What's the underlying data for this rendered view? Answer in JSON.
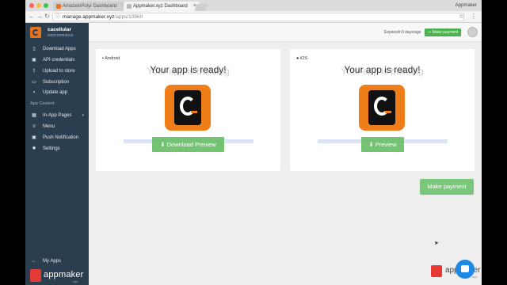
{
  "browser": {
    "tabs": [
      {
        "label": "AmazeinPolyr Dashboard",
        "active": false
      },
      {
        "label": "Appmaker.xyz Dashboard",
        "active": true
      }
    ],
    "profile_name": "Appmaker",
    "url_host": "manage.appmaker.xyz",
    "url_path": "/apps/10960"
  },
  "sidebar": {
    "app_name": "cacellular",
    "app_subtitle": "woocommerce",
    "items": [
      {
        "label": "Download Apps",
        "icon": "phone-icon"
      },
      {
        "label": "API credentials",
        "icon": "lock-icon"
      },
      {
        "label": "Upload to store",
        "icon": "upload-icon"
      },
      {
        "label": "Subscription",
        "icon": "card-icon"
      },
      {
        "label": "Update app",
        "icon": "update-icon"
      }
    ],
    "section_title": "App Content",
    "content_items": [
      {
        "label": "In-App Pages",
        "icon": "grid-icon"
      },
      {
        "label": "Menu",
        "icon": "list-icon"
      },
      {
        "label": "Push Notification",
        "icon": "bell-icon"
      },
      {
        "label": "Settings",
        "icon": "gear-icon"
      }
    ],
    "my_apps": "My Apps",
    "logo_text": "appmaker",
    "logo_sub": ".xyz"
  },
  "topbar": {
    "expires_text": "Expires/in3 days/age",
    "make_payment_small": "Make payment"
  },
  "cards": [
    {
      "platform": "Android",
      "heading": "Your app is ready!",
      "ghost_text": "Your app is building",
      "button": "Download Preview",
      "progress_fraction": 1.0
    },
    {
      "platform": "iOS",
      "heading": "Your app is ready!",
      "ghost_text": "Your app is building",
      "button": "Preview",
      "progress_fraction": 1.0
    }
  ],
  "make_payment": "Make payment",
  "footer_logo": {
    "text": "appmaker",
    "sub": ".xyz"
  },
  "colors": {
    "sidebar": "#2b3e50",
    "accent_green": "#4caf50",
    "brand_orange": "#ee7d1a",
    "brand_red": "#e53935",
    "chat_blue": "#1e88e5"
  }
}
